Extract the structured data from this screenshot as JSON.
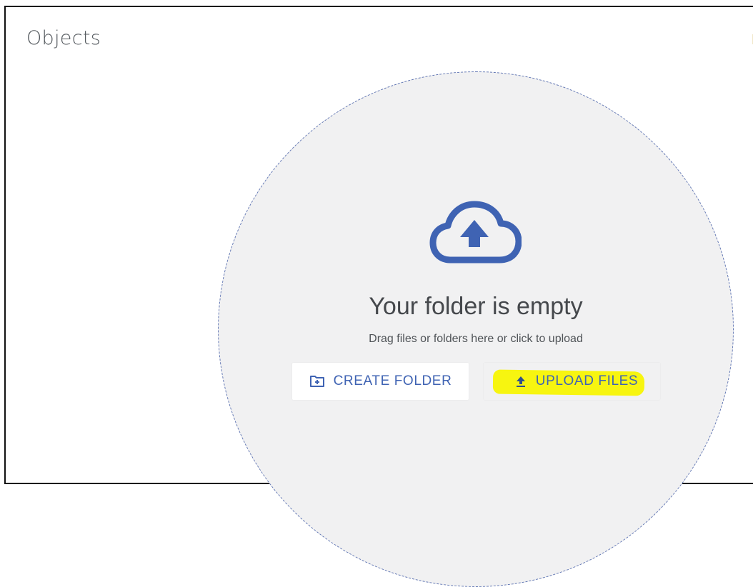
{
  "header": {
    "title": "Objects"
  },
  "empty_state": {
    "heading": "Your folder is empty",
    "helper": "Drag files or folders here or click to upload"
  },
  "actions": {
    "create_folder_label": "CREATE FOLDER",
    "upload_files_label": "UPLOAD FILES"
  },
  "icons": {
    "cloud": "cloud-upload-icon",
    "folder": "folder-plus-icon",
    "upload": "upload-arrow-icon"
  },
  "colors": {
    "accent": "#3f63b3",
    "dropzone_fill": "#f1f1f2",
    "dropzone_border": "#6277b4",
    "highlight": "#f7f510"
  }
}
